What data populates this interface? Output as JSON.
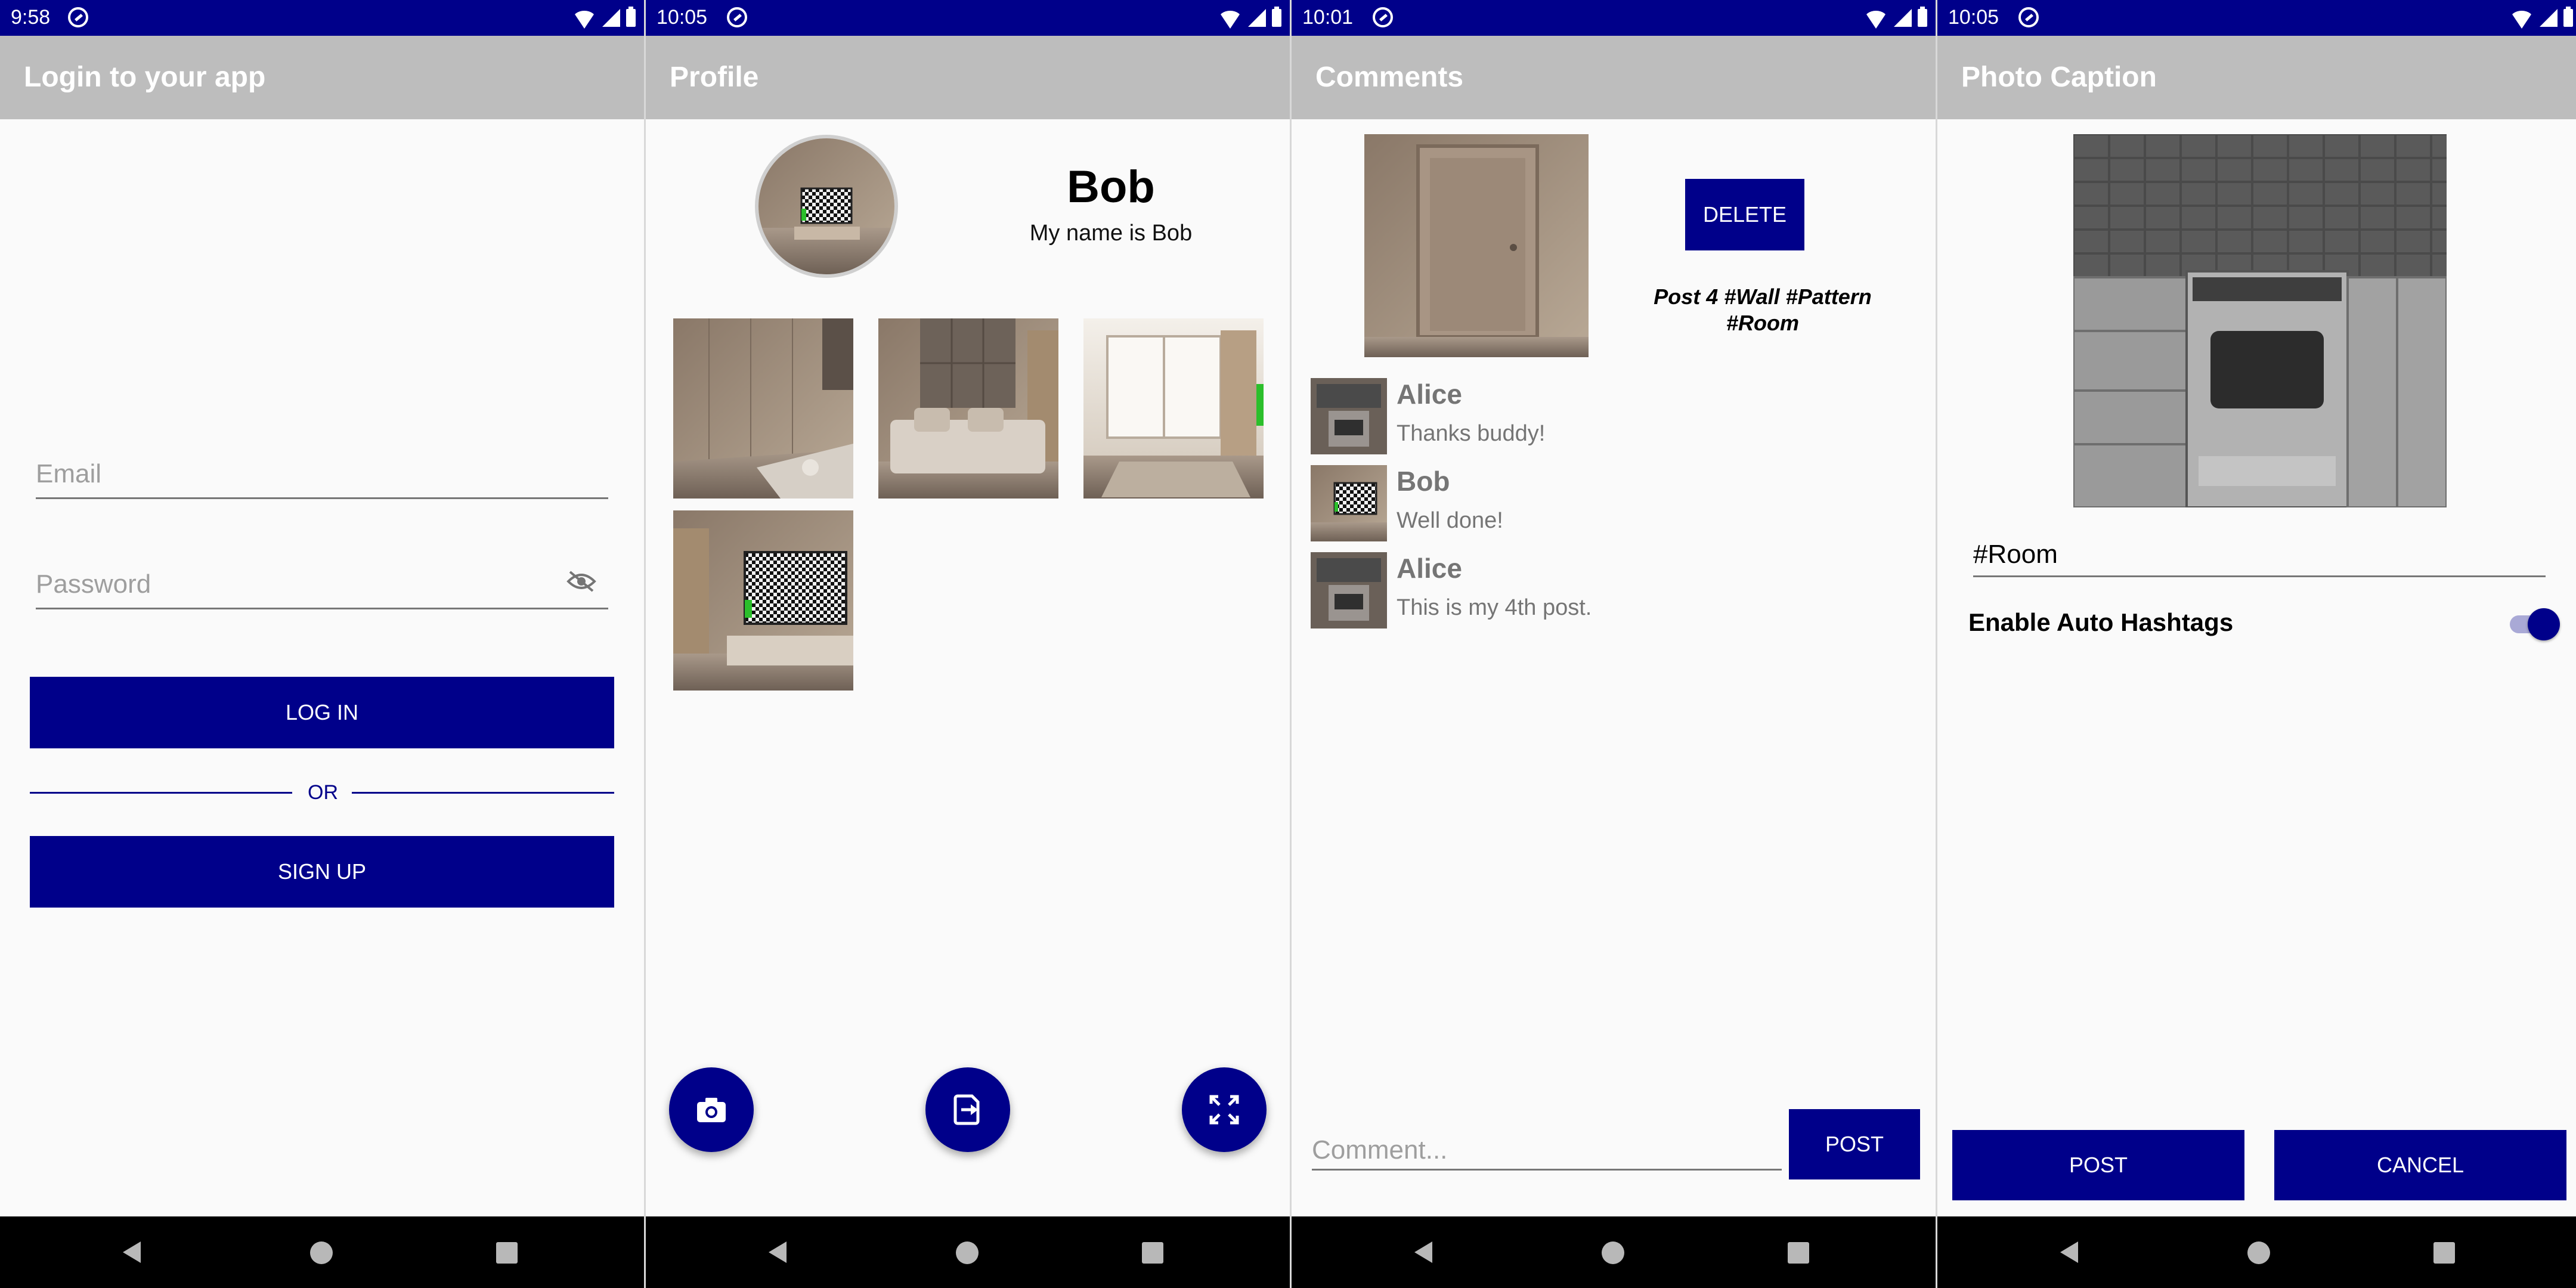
{
  "status_bars": [
    {
      "time": "9:58"
    },
    {
      "time": "10:05"
    },
    {
      "time": "10:01"
    },
    {
      "time": "10:05"
    }
  ],
  "login": {
    "title": "Login to your app",
    "email_placeholder": "Email",
    "password_placeholder": "Password",
    "login_label": "LOG IN",
    "or_label": "OR",
    "signup_label": "SIGN UP"
  },
  "profile": {
    "title": "Profile",
    "name": "Bob",
    "bio": "My name is Bob"
  },
  "comments": {
    "title": "Comments",
    "delete_label": "DELETE",
    "post_caption": "Post 4 #Wall #Pattern #Room",
    "items": [
      {
        "user": "Alice",
        "text": "Thanks buddy!"
      },
      {
        "user": "Bob",
        "text": "Well done!"
      },
      {
        "user": "Alice",
        "text": "This is my 4th post."
      }
    ],
    "comment_placeholder": "Comment...",
    "post_label": "POST"
  },
  "caption": {
    "title": "Photo Caption",
    "caption_value": "#Room",
    "toggle_label": "Enable Auto Hashtags",
    "toggle_on": true,
    "post_label": "POST",
    "cancel_label": "CANCEL"
  },
  "colors": {
    "primary": "#00008a",
    "appbar": "#bdbdbd",
    "background": "#fafafa"
  }
}
